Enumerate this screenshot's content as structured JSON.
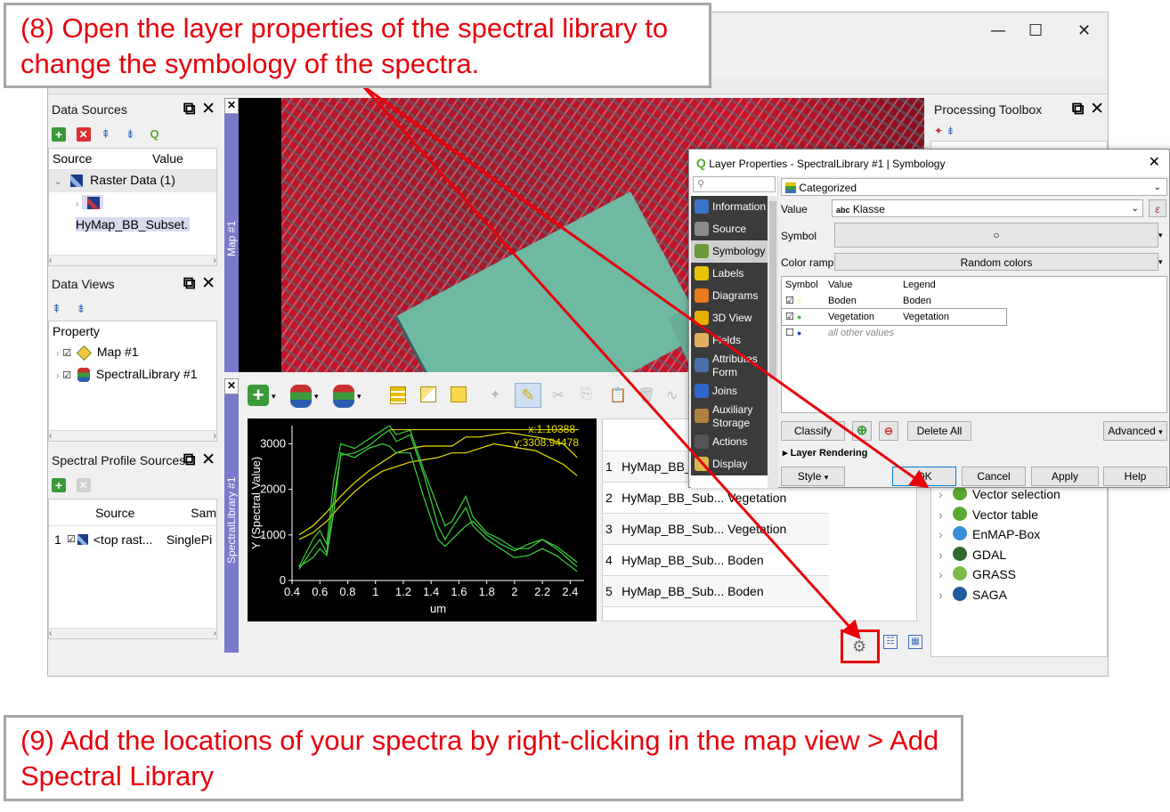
{
  "callouts": {
    "top": "(8) Open the layer properties of the spectral library to change the symbology of the spectra.",
    "bottom": "(9) Add the locations of your spectra by right-clicking in the map view > Add Spectral Library"
  },
  "window_controls": {
    "minimize": "—",
    "maximize": "☐",
    "close": "✕"
  },
  "data_sources": {
    "title": "Data Sources",
    "col_source": "Source",
    "col_value": "Value",
    "group": "Raster Data (1)",
    "item": "HyMap_BB_Subset."
  },
  "data_views": {
    "title": "Data Views",
    "col_property": "Property",
    "items": [
      "Map #1",
      "SpectralLibrary #1"
    ]
  },
  "spectral_sources": {
    "title": "Spectral Profile Sources",
    "col_source": "Source",
    "col_sampling": "Sam",
    "row_num": "1",
    "row_source": "<top rast...",
    "row_sampling": "SinglePi"
  },
  "map_dock": {
    "label": "Map #1"
  },
  "speclib_dock": {
    "label": "SpectralLibrary #1"
  },
  "plot": {
    "cursor_x": "x:1.10388",
    "cursor_y": "y:3308.94478"
  },
  "chart_data": {
    "type": "line",
    "xlabel": "um",
    "ylabel": "Y (Spectral Value)",
    "xlim": [
      0.4,
      2.5
    ],
    "ylim": [
      0,
      3400
    ],
    "x_ticks": [
      "0.4",
      "0.6",
      "0.8",
      "1",
      "1.2",
      "1.4",
      "1.6",
      "1.8",
      "2",
      "2.2",
      "2.4"
    ],
    "y_ticks": [
      "0",
      "1000",
      "2000",
      "3000"
    ],
    "series": [
      {
        "color": "#e8e000",
        "x": [
          0.45,
          0.55,
          0.65,
          0.75,
          0.85,
          0.95,
          1.05,
          1.15,
          1.25,
          1.35,
          1.45,
          1.55,
          1.65,
          1.75,
          1.85,
          1.95,
          2.05,
          2.15,
          2.25,
          2.35,
          2.45
        ],
        "y": [
          1000,
          1200,
          1500,
          1850,
          2150,
          2400,
          2600,
          2800,
          2900,
          2950,
          2950,
          2950,
          3150,
          3150,
          3200,
          3250,
          3200,
          3150,
          3100,
          3000,
          2700
        ]
      },
      {
        "color": "#e8e000",
        "x": [
          0.45,
          0.55,
          0.65,
          0.75,
          0.85,
          0.95,
          1.05,
          1.15,
          1.25,
          1.35,
          1.45,
          1.55,
          1.65,
          1.75,
          1.85,
          1.95,
          2.05,
          2.15,
          2.25,
          2.35,
          2.45
        ],
        "y": [
          900,
          1050,
          1300,
          1650,
          1950,
          2200,
          2400,
          2500,
          2600,
          2650,
          2700,
          2800,
          2800,
          2900,
          3000,
          2950,
          2900,
          2850,
          2700,
          2550,
          2300
        ]
      },
      {
        "color": "#3dd23d",
        "x": [
          0.45,
          0.55,
          0.6,
          0.65,
          0.7,
          0.75,
          0.85,
          0.95,
          1.05,
          1.1,
          1.15,
          1.25,
          1.35,
          1.45,
          1.5,
          1.55,
          1.65,
          1.7,
          1.8,
          1.9,
          2.0,
          2.1,
          2.2,
          2.3,
          2.45
        ],
        "y": [
          300,
          900,
          1100,
          800,
          2200,
          3000,
          2900,
          3100,
          3300,
          3400,
          3200,
          3300,
          2400,
          1600,
          1200,
          1300,
          1850,
          1400,
          1050,
          900,
          700,
          700,
          900,
          700,
          300
        ]
      },
      {
        "color": "#3dd23d",
        "x": [
          0.45,
          0.55,
          0.6,
          0.65,
          0.7,
          0.75,
          0.85,
          0.95,
          1.05,
          1.1,
          1.15,
          1.25,
          1.35,
          1.45,
          1.5,
          1.55,
          1.65,
          1.7,
          1.8,
          1.9,
          2.0,
          2.1,
          2.2,
          2.3,
          2.45
        ],
        "y": [
          250,
          700,
          900,
          600,
          1800,
          2750,
          2800,
          2950,
          3200,
          3300,
          3050,
          3200,
          2300,
          1200,
          900,
          1150,
          1600,
          1200,
          900,
          700,
          500,
          550,
          700,
          550,
          200
        ]
      },
      {
        "color": "#3dd23d",
        "x": [
          0.45,
          0.55,
          0.6,
          0.65,
          0.7,
          0.75,
          0.85,
          0.95,
          1.05,
          1.1,
          1.15,
          1.25,
          1.35,
          1.45,
          1.5,
          1.55,
          1.65,
          1.7,
          1.8,
          1.9,
          2.0,
          2.1,
          2.2,
          2.3,
          2.45
        ],
        "y": [
          300,
          500,
          700,
          550,
          1500,
          2800,
          2700,
          2900,
          3000,
          2950,
          2800,
          2800,
          1800,
          900,
          750,
          900,
          1200,
          1300,
          1000,
          800,
          650,
          800,
          900,
          750,
          400
        ]
      }
    ]
  },
  "speclib_table": {
    "col_name": "name",
    "rows": [
      {
        "num": "1",
        "name": "HyMap_BB_Sub...",
        "value": ""
      },
      {
        "num": "2",
        "name": "HyMap_BB_Sub...",
        "value": "Vegetation"
      },
      {
        "num": "3",
        "name": "HyMap_BB_Sub...",
        "value": "Vegetation"
      },
      {
        "num": "4",
        "name": "HyMap_BB_Sub...",
        "value": "Boden"
      },
      {
        "num": "5",
        "name": "HyMap_BB_Sub...",
        "value": "Boden"
      }
    ]
  },
  "processing_toolbox": {
    "title": "Processing Toolbox",
    "items": [
      {
        "label": "Vector selection",
        "icon_color": "#5aa832"
      },
      {
        "label": "Vector table",
        "icon_color": "#5aa832"
      },
      {
        "label": "EnMAP-Box",
        "icon_color": "#3a8dd8"
      },
      {
        "label": "GDAL",
        "icon_color": "#2d6b2d"
      },
      {
        "label": "GRASS",
        "icon_color": "#7bbb4a"
      },
      {
        "label": "SAGA",
        "icon_color": "#1f5a9e"
      }
    ]
  },
  "layer_props": {
    "title": "Layer Properties - SpectralLibrary #1 | Symbology",
    "close": "✕",
    "sidebar": [
      {
        "label": "Information",
        "icon_color": "#3b73c8"
      },
      {
        "label": "Source",
        "icon_color": "#8a8a8a"
      },
      {
        "label": "Symbology",
        "icon_color": "#6a9a3a"
      },
      {
        "label": "Labels",
        "icon_color": "#e6c300"
      },
      {
        "label": "Diagrams",
        "icon_color": "#e87b1a"
      },
      {
        "label": "3D View",
        "icon_color": "#e8b000"
      },
      {
        "label": "Fields",
        "icon_color": "#e0b060"
      },
      {
        "label": "Attributes\nForm",
        "icon_color": "#4a6fa8"
      },
      {
        "label": "Joins",
        "icon_color": "#3366cc"
      },
      {
        "label": "Auxiliary\nStorage",
        "icon_color": "#b08040"
      },
      {
        "label": "Actions",
        "icon_color": "#555555"
      },
      {
        "label": "Display",
        "icon_color": "#d8b848"
      }
    ],
    "renderer": "Categorized",
    "value_label": "Value",
    "value_field": "Klasse",
    "value_prefix": "abc",
    "symbol_label": "Symbol",
    "color_ramp_label": "Color ramp",
    "color_ramp": "Random colors",
    "cat_headers": {
      "symbol": "Symbol",
      "value": "Value",
      "legend": "Legend"
    },
    "categories": [
      {
        "value": "Boden",
        "legend": "Boden",
        "color": "#e8d000"
      },
      {
        "value": "Vegetation",
        "legend": "Vegetation",
        "color": "#3dbb3d"
      },
      {
        "value": "all other values",
        "legend": "",
        "color": "#2244cc"
      }
    ],
    "buttons": {
      "classify": "Classify",
      "delete_all": "Delete All",
      "advanced": "Advanced",
      "layer_rendering": "Layer Rendering",
      "style": "Style",
      "ok": "OK",
      "cancel": "Cancel",
      "apply": "Apply",
      "help": "Help"
    }
  }
}
